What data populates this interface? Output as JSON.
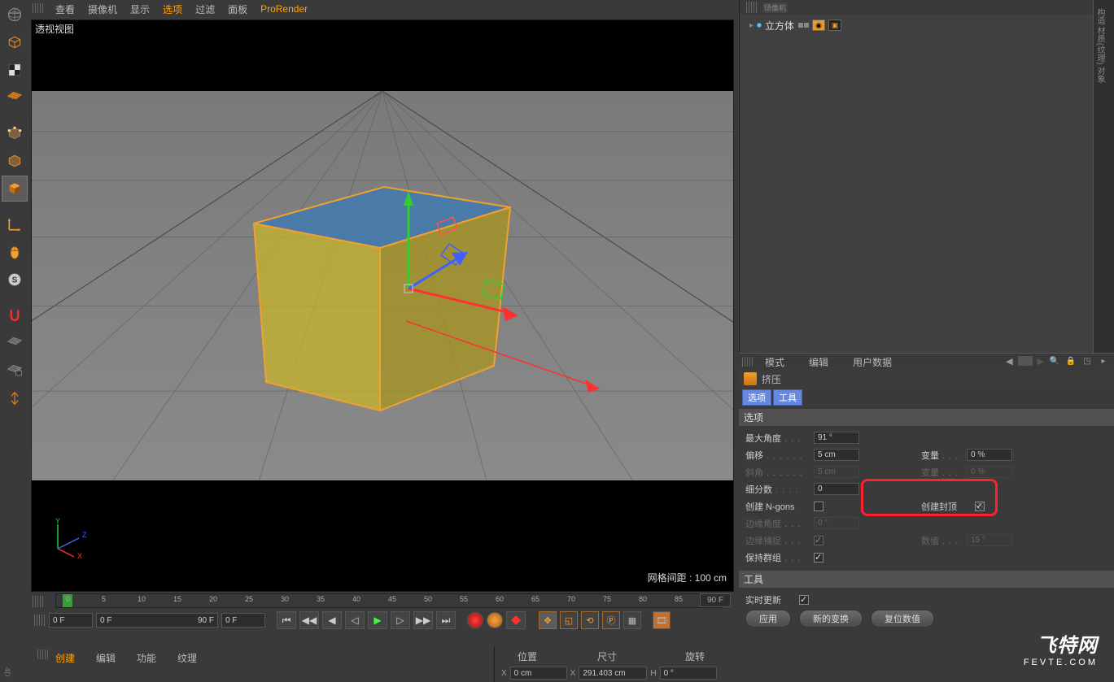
{
  "viewport_menu": {
    "items": [
      "查看",
      "摄像机",
      "显示",
      "选项",
      "过滤",
      "面板",
      "ProRender"
    ],
    "highlighted": "选项",
    "extra_highlight": "ProRender"
  },
  "viewport_label": "透视视图",
  "grid_info": "网格间距 : 100 cm",
  "timeline": {
    "start_frame": "0 F",
    "range_start": "0 F",
    "range_end": "90 F",
    "current": "0 F",
    "end_display": "90 F",
    "ticks": [
      "0",
      "5",
      "10",
      "15",
      "20",
      "25",
      "30",
      "35",
      "40",
      "45",
      "50",
      "55",
      "60",
      "65",
      "70",
      "75",
      "80",
      "85",
      "90"
    ]
  },
  "object_manager": {
    "label_partial": "玚像机",
    "item": "立方体"
  },
  "attr_menu": {
    "items": [
      "模式",
      "编辑",
      "用户数据"
    ]
  },
  "attr_title": "挤压",
  "attr_tabs": [
    "选项",
    "工具"
  ],
  "section_options": "选项",
  "section_tools": "工具",
  "props": {
    "max_angle": {
      "label": "最大角度",
      "value": "91 °"
    },
    "offset": {
      "label": "偏移",
      "value": "5 cm"
    },
    "var1": {
      "label": "变量",
      "value": "0 %"
    },
    "bevel": {
      "label": "斜角",
      "value": "5 cm"
    },
    "var2": {
      "label": "变量",
      "value": "0 %"
    },
    "subdiv": {
      "label": "细分数",
      "value": "0"
    },
    "ngons": {
      "label": "创建 N-gons"
    },
    "create_cap": {
      "label": "创建封顶"
    },
    "edge_angle": {
      "label": "边缘角度",
      "value": "0 °"
    },
    "edge_snap": {
      "label": "边缘捕捉"
    },
    "num_val": {
      "label": "数值",
      "value": "15 °"
    },
    "keep_groups": {
      "label": "保持群组"
    }
  },
  "tools_section": {
    "realtime": "实时更新",
    "apply": "应用",
    "new_transform": "新的变换",
    "reset_values": "复位数值"
  },
  "bottom_tabs": {
    "items": [
      "创建",
      "编辑",
      "功能",
      "纹理"
    ],
    "highlighted": "创建"
  },
  "coords": {
    "header_pos": "位置",
    "header_size": "尺寸",
    "header_rot": "旋转",
    "x": {
      "label": "X",
      "pos": "0 cm",
      "size": "291.403 cm",
      "rot": "0 °"
    }
  },
  "watermark": {
    "big": "飞特网",
    "small": "FEVTE.COM"
  },
  "sidebar_labels": "构造 材质(纹理) 对象"
}
